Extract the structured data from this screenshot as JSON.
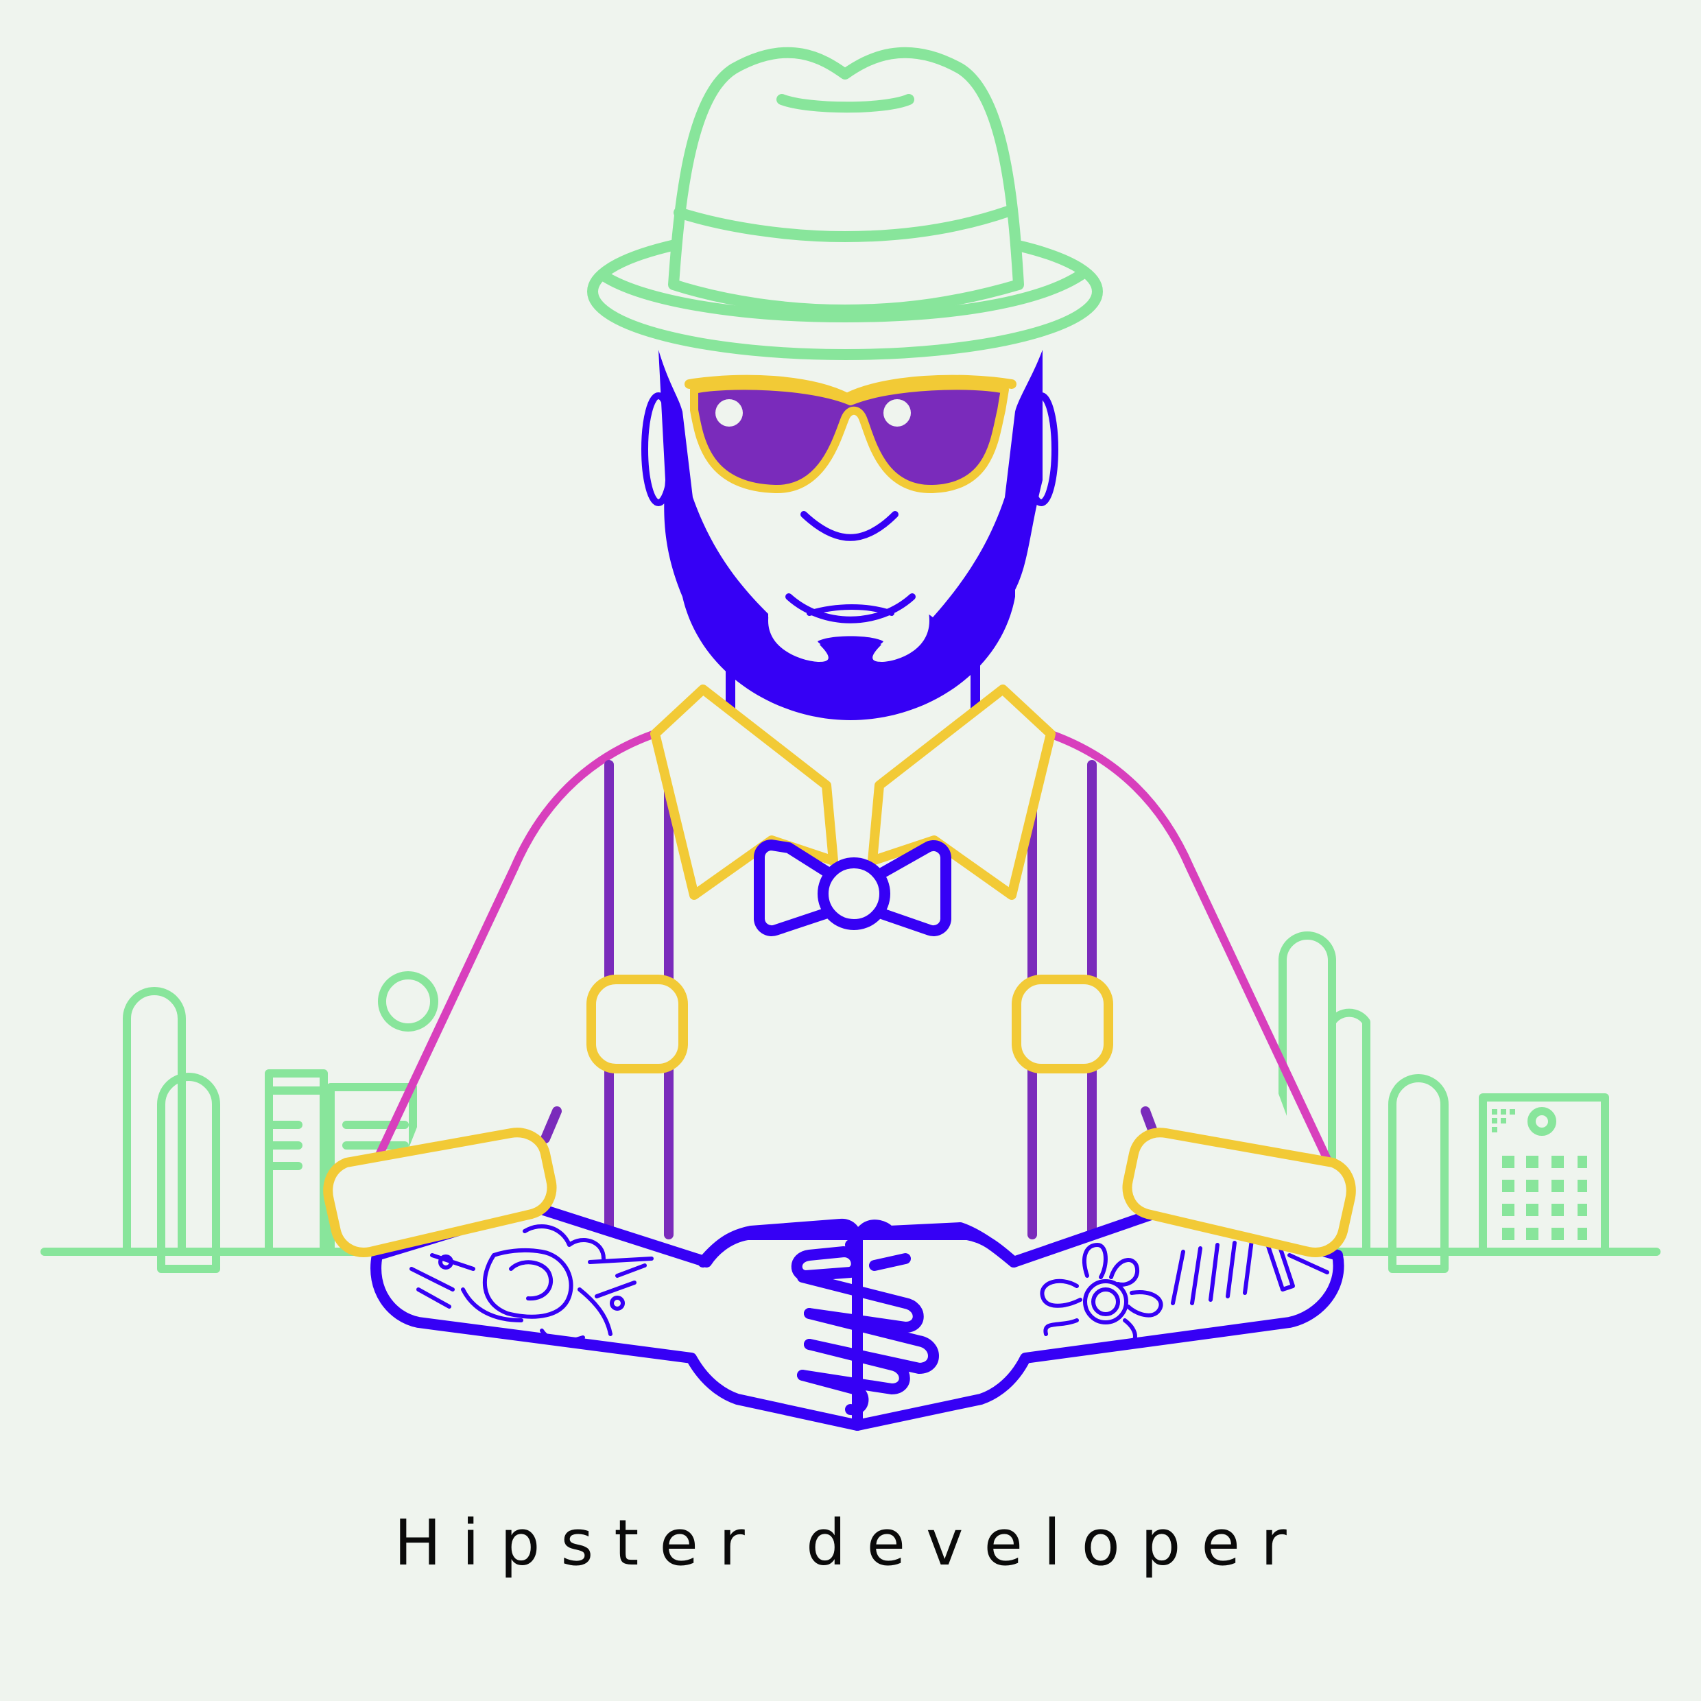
{
  "caption": "Hipster developer",
  "palette": {
    "background": "#eff4ee",
    "city_green": "#88e59b",
    "hat_green": "#88e59b",
    "blue": "#3600f5",
    "purple": "#7a2bbb",
    "yellow": "#f2ca36",
    "magenta": "#d83fbd"
  },
  "icons": [
    "city-skyline-icon",
    "hat-icon",
    "sunglasses-icon",
    "beard-icon",
    "bow-tie-icon",
    "suspenders-icon",
    "tattoo-rose-icon",
    "tattoo-flower-icon",
    "folded-hands-icon"
  ]
}
